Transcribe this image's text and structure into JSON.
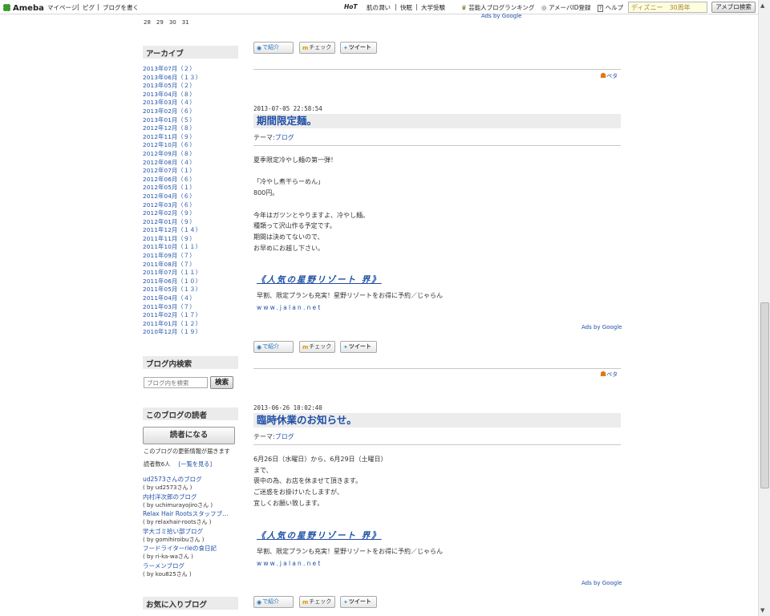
{
  "topbar": {
    "logo": "Ameba",
    "mypage": "マイページ",
    "pigg": "ピグ",
    "write_blog": "ブログを書く",
    "hot": "HoT",
    "hot_item_1": "肌の潤い",
    "hot_item_2": "快眠",
    "hot_item_3": "大学受験",
    "ranking": "芸能人ブログランキング",
    "register": "アメーバID登録",
    "help": "ヘルプ",
    "search_value": "ディズニー　30周年",
    "search_button": "アメブロ検索"
  },
  "sidebar": {
    "calendar_tail": "28　29　30　31",
    "archive_heading": "アーカイブ",
    "archive": [
      "2013年07月（２）",
      "2013年06月（１３）",
      "2013年05月（２）",
      "2013年04月（８）",
      "2013年03月（４）",
      "2013年02月（６）",
      "2013年01月（５）",
      "2012年12月（８）",
      "2012年11月（９）",
      "2012年10月（６）",
      "2012年09月（８）",
      "2012年08月（４）",
      "2012年07月（１）",
      "2012年06月（６）",
      "2012年05月（１）",
      "2012年04月（６）",
      "2012年03月（６）",
      "2012年02月（９）",
      "2012年01月（９）",
      "2011年12月（１４）",
      "2011年11月（９）",
      "2011年10月（１１）",
      "2011年09月（７）",
      "2011年08月（７）",
      "2011年07月（１１）",
      "2011年06月（１０）",
      "2011年05月（１３）",
      "2011年04月（４）",
      "2011年03月（７）",
      "2011年02月（１７）",
      "2011年01月（１２）",
      "2010年12月（１９）"
    ],
    "blog_search_heading": "ブログ内検索",
    "blog_search_placeholder": "ブログ内を検索",
    "blog_search_button": "検索",
    "readers_heading": "このブログの読者",
    "reader_button": "読者になる",
    "reader_note": "このブログの更新情報が届きます",
    "reader_count": "読者数6人",
    "reader_list_link": "[一覧を見る]",
    "readers": [
      {
        "name": "ud2573さんのブログ",
        "by": "( by ud2573さん )"
      },
      {
        "name": "内村洋次郎のブログ",
        "by": "( by uchimurayojiroさん )"
      },
      {
        "name": "Relax Hair Rootsスタッフブ…",
        "by": "( by relaxhair-rootsさん )"
      },
      {
        "name": "学大ゴミ拾い部ブログ",
        "by": "( by gomihiroibuさん )"
      },
      {
        "name": "フードライターrieの食日記",
        "by": "( by ri-ka-waさん )"
      },
      {
        "name": "ラーメンブログ",
        "by": "( by kou825さん )"
      }
    ],
    "favorites_heading": "お気に入りブログ"
  },
  "main": {
    "top_ads_by_google": "Ads by Google",
    "share": {
      "intro": "で紹介",
      "check": "チェック",
      "tweet": "ツイート"
    },
    "peta": "ペタ",
    "theme_label": "テーマ:",
    "posts": [
      {
        "date": "2013-07-05 22:58:54",
        "title": "期間限定麺。",
        "theme": "ブログ",
        "body": "夏季限定冷やし麺の第一弾！\n\n「冷やし煮干らーめん」\n800円。\n\n今年はガツンとやりますよ、冷やし麺。\n種類って沢山作る予定です。\n期間は決めてないので、\nお早めにお越し下さい。",
        "ad_title": "《人気の星野リゾート 界》",
        "ad_desc": "早割、限定プランも充実！星野リゾートをお得に予約／じゃらん",
        "ad_url": "www.jalan.net",
        "ads_by_google": "Ads by Google"
      },
      {
        "date": "2013-06-26 10:02:40",
        "title": "臨時休業のお知らせ。",
        "theme": "ブログ",
        "body": "6月26日（水曜日）から、6月29日（土曜日）\nまで、\n褒中の為、お店を休ませて頂きます。\nご迷惑をお掛けいたしますが、\n宜しくお願い致します。",
        "ad_title": "《人気の星野リゾート 界》",
        "ad_desc": "早割、限定プランも充実！星野リゾートをお得に予約／じゃらん",
        "ad_url": "www.jalan.net",
        "ads_by_google": "Ads by Google"
      }
    ]
  }
}
